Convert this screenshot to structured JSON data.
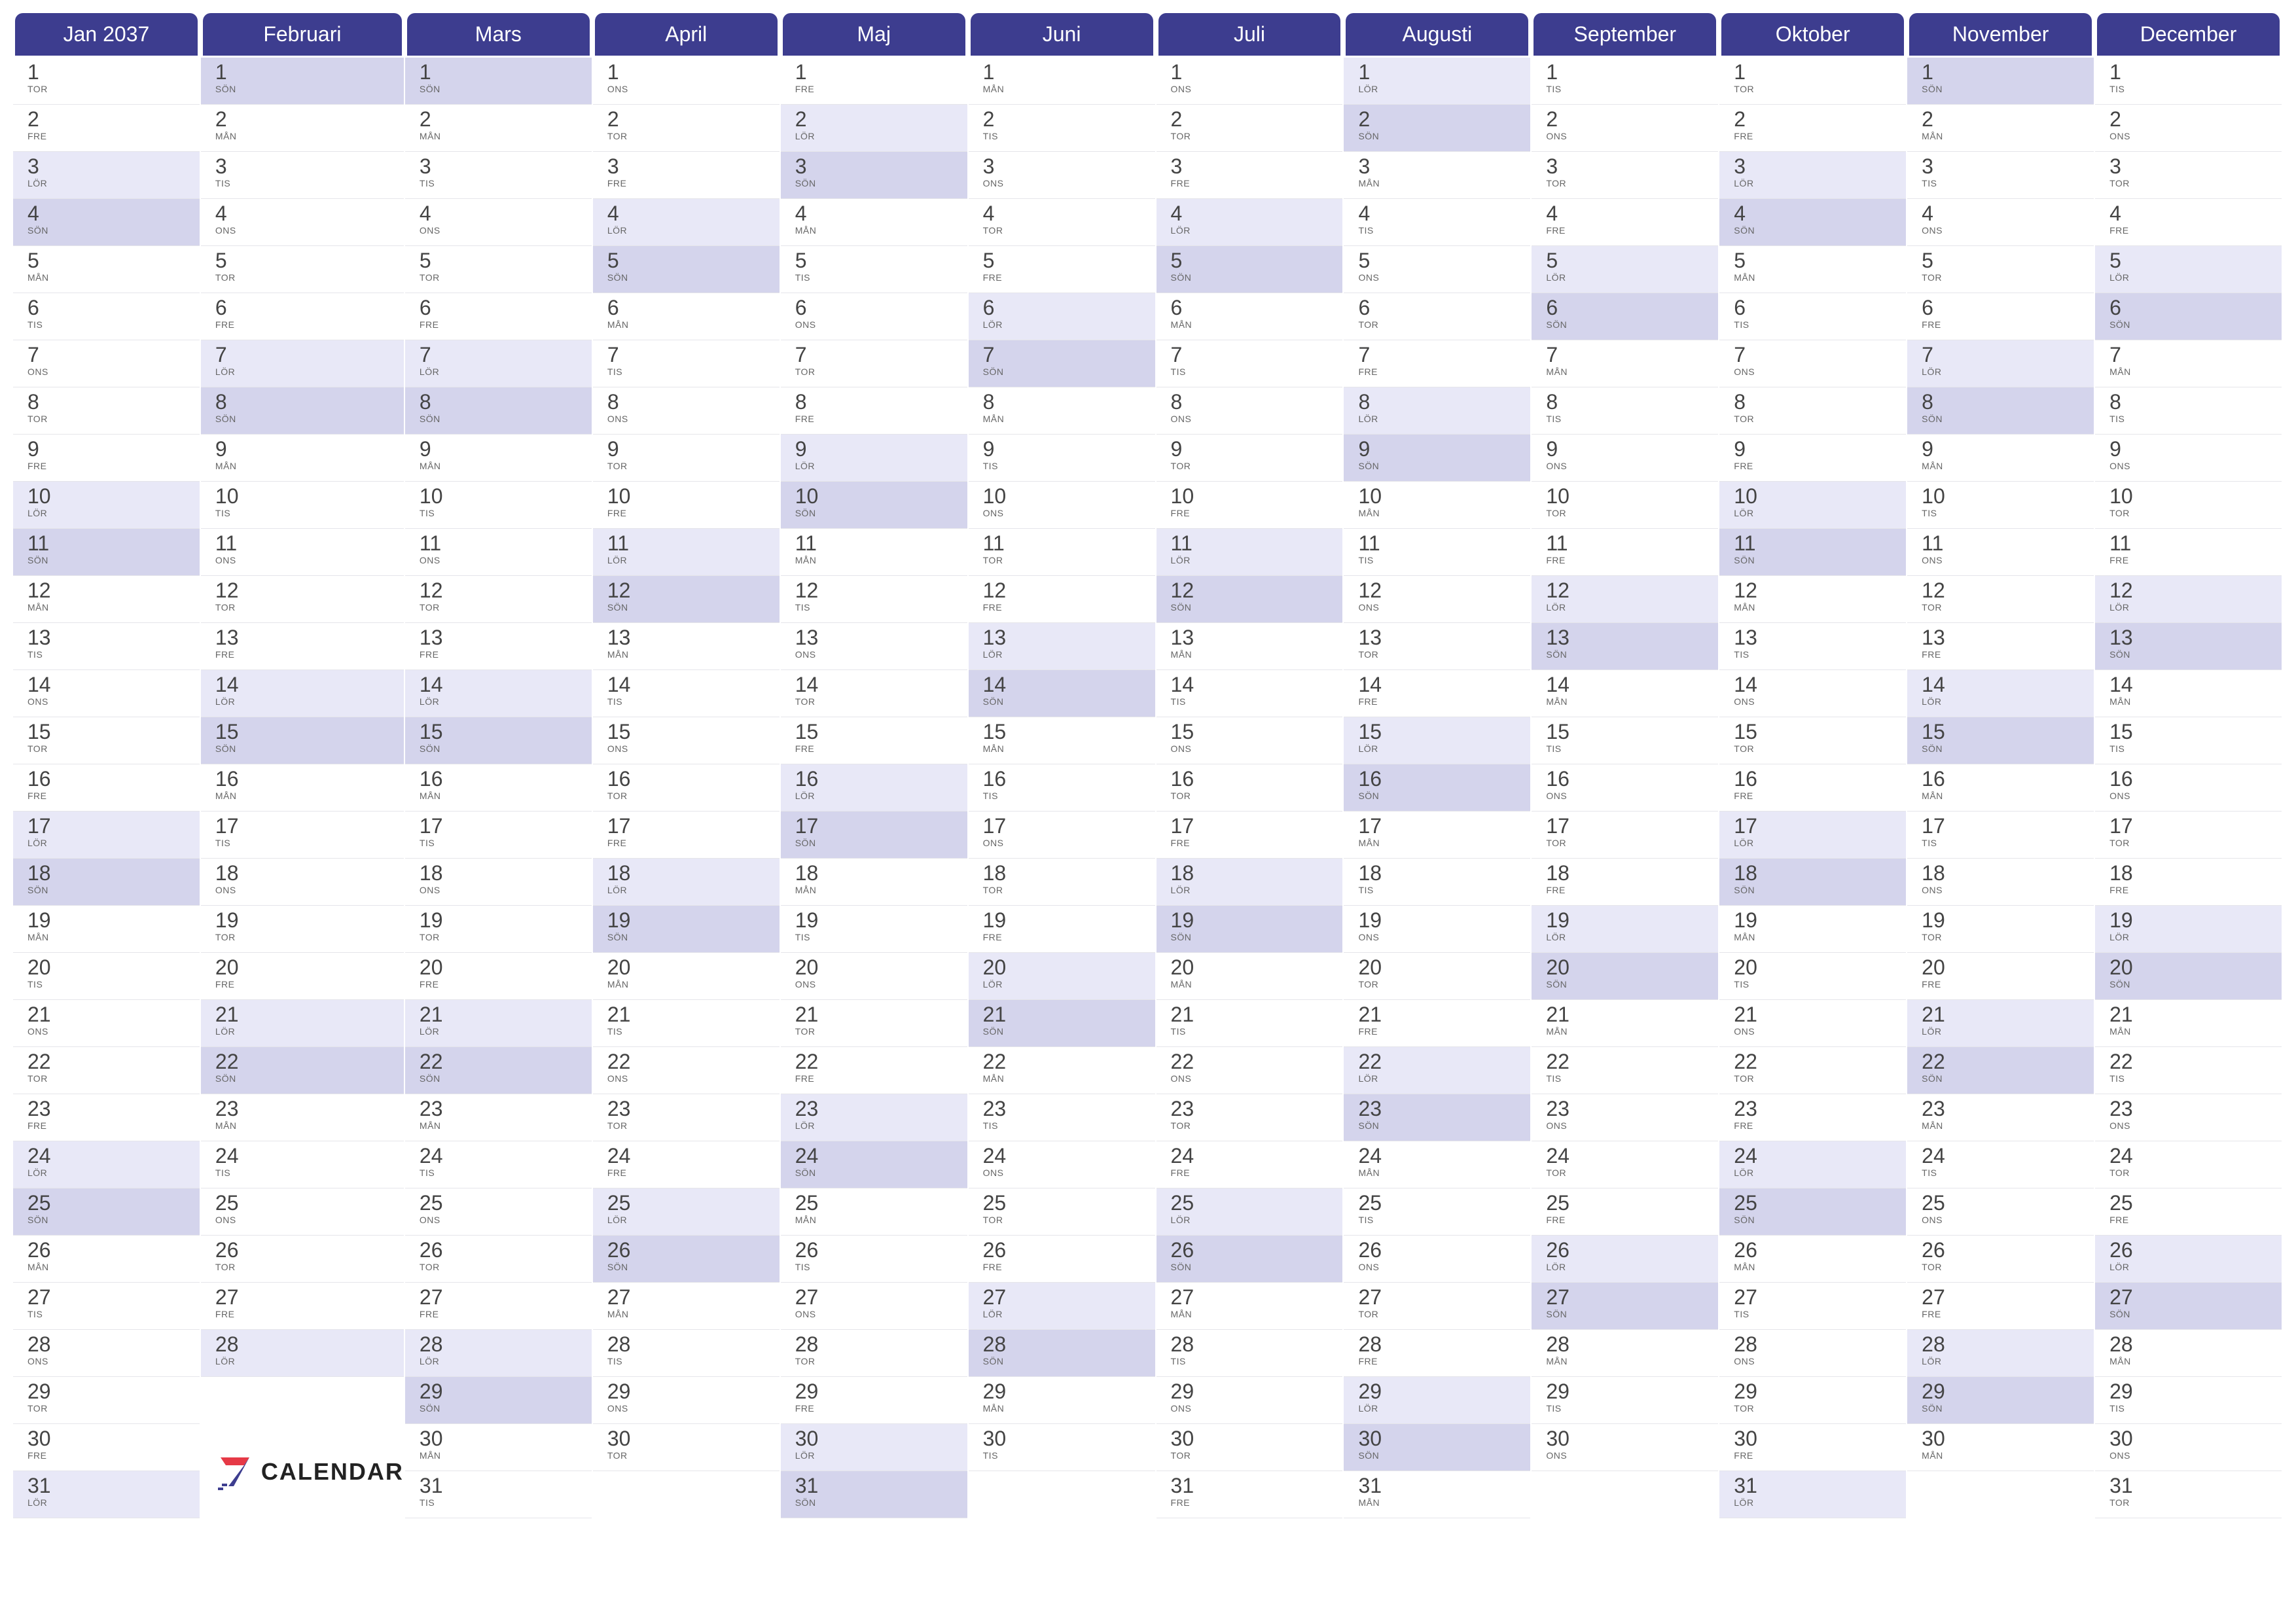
{
  "year": 2037,
  "brand": "CALENDAR",
  "dowLabels": [
    "SÖN",
    "MÅN",
    "TIS",
    "ONS",
    "TOR",
    "FRE",
    "LÖR"
  ],
  "months": [
    {
      "name": "Jan 2037",
      "days": 31,
      "startDow": 4
    },
    {
      "name": "Februari",
      "days": 28,
      "startDow": 0
    },
    {
      "name": "Mars",
      "days": 31,
      "startDow": 0
    },
    {
      "name": "April",
      "days": 30,
      "startDow": 3
    },
    {
      "name": "Maj",
      "days": 31,
      "startDow": 5
    },
    {
      "name": "Juni",
      "days": 30,
      "startDow": 1
    },
    {
      "name": "Juli",
      "days": 31,
      "startDow": 3
    },
    {
      "name": "Augusti",
      "days": 31,
      "startDow": 6
    },
    {
      "name": "September",
      "days": 30,
      "startDow": 2
    },
    {
      "name": "Oktober",
      "days": 31,
      "startDow": 4
    },
    {
      "name": "November",
      "days": 30,
      "startDow": 0
    },
    {
      "name": "December",
      "days": 31,
      "startDow": 2
    }
  ]
}
